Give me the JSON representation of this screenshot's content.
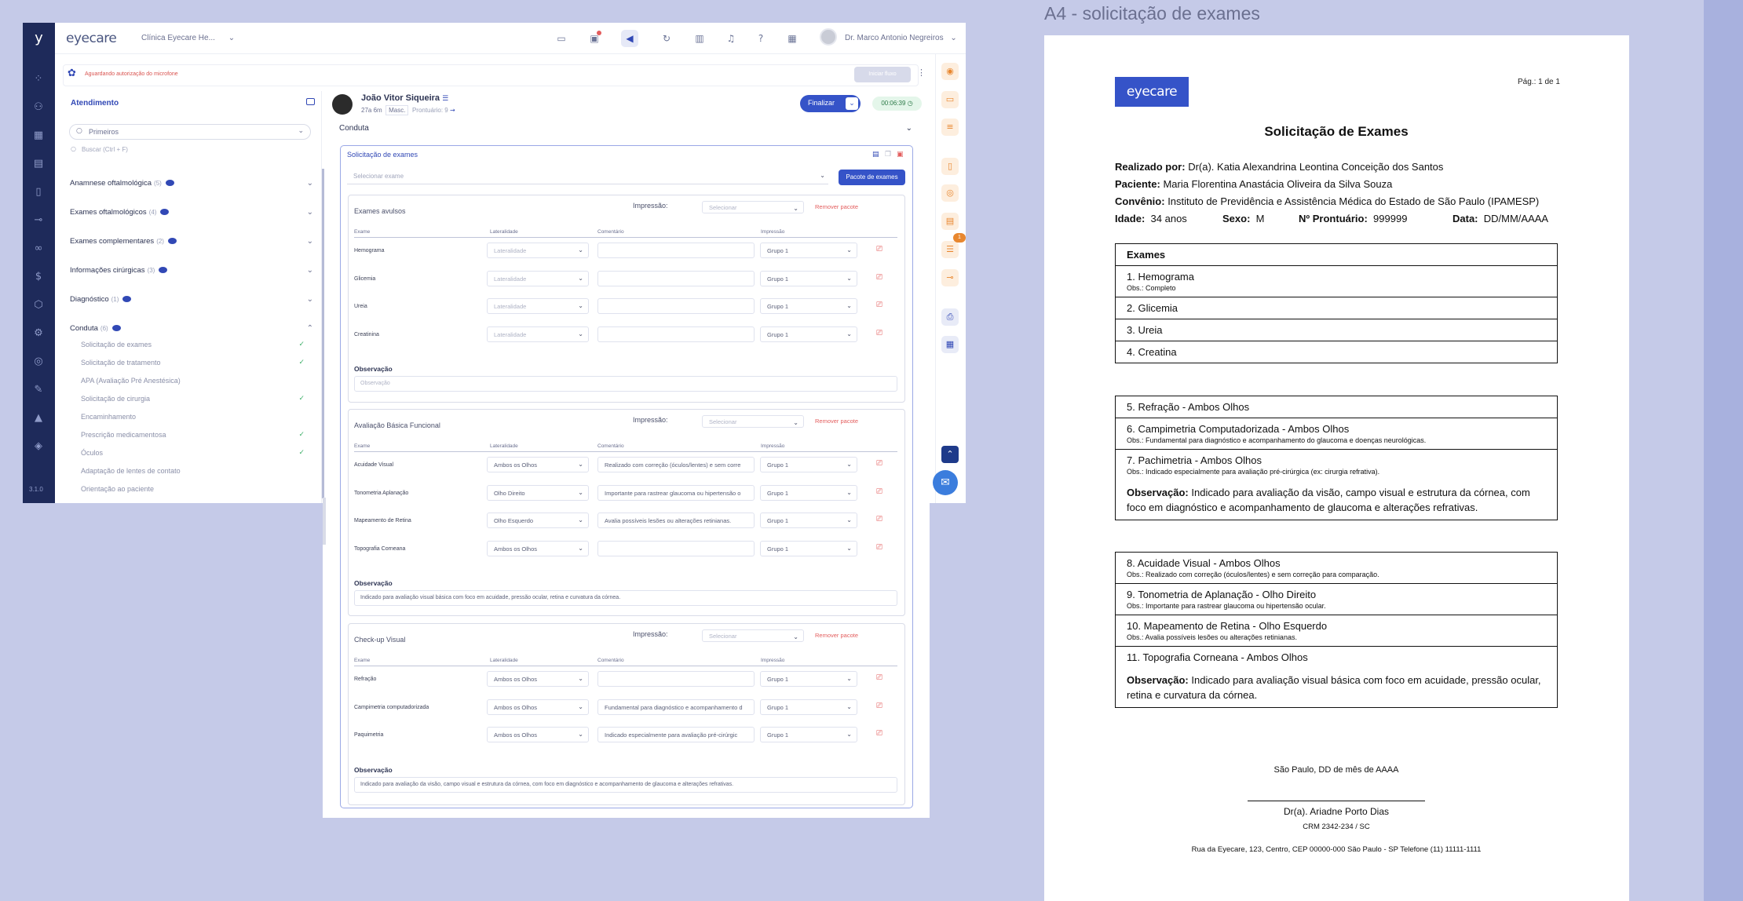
{
  "app": {
    "logo_letter": "y",
    "brand": "eyecare",
    "clinic": "Clínica Eyecare He...",
    "doctor": "Dr. Marco Antonio Negreiros",
    "version": "3.1.0",
    "status": "Aguardando autorização do microfone",
    "lock_button": "Iniciar fluxo"
  },
  "sidebar": {
    "title": "Atendimento",
    "select": "Primeiros",
    "search_placeholder": "Buscar (Ctrl + F)",
    "sections": [
      {
        "label": "Anamnese oftalmológica",
        "count": "(5)"
      },
      {
        "label": "Exames oftalmológicos",
        "count": "(4)"
      },
      {
        "label": "Exames complementares",
        "count": "(2)"
      },
      {
        "label": "Informações cirúrgicas",
        "count": "(3)"
      },
      {
        "label": "Diagnóstico",
        "count": "(1)"
      },
      {
        "label": "Conduta",
        "count": "(6)"
      }
    ],
    "items": [
      "Solicitação de exames",
      "Solicitação de tratamento",
      "APA (Avaliação Pré Anestésica)",
      "Solicitação de cirurgia",
      "Encaminhamento",
      "Prescrição medicamentosa",
      "Óculos",
      "Adaptação de lentes de contato",
      "Orientação ao paciente"
    ]
  },
  "patient": {
    "name": "João Vitor Siqueira",
    "age": "27a 6m",
    "sex": "Masc.",
    "record": "Prontuário: 9"
  },
  "actions": {
    "finalize": "Finalizar",
    "timer": "00:06:39"
  },
  "section_title": "Conduta",
  "exam_card": {
    "title": "Solicitação de exames",
    "select_placeholder": "Selecionar exame",
    "package_button": "Pacote de exames",
    "impression_label": "Impressão:",
    "impression_placeholder": "Selecionar",
    "remove_package": "Remover pacote",
    "col_exam": "Exame",
    "col_laterality": "Lateralidade",
    "col_comment": "Comentário",
    "col_print": "Impressão",
    "obs_label": "Observação",
    "obs_placeholder": "Observação",
    "packages": [
      {
        "title": "Exames avulsos",
        "rows": [
          {
            "exam": "Hemograma",
            "lat": "Lateralidade",
            "comment": "",
            "print": "Grupo 1"
          },
          {
            "exam": "Glicemia",
            "lat": "Lateralidade",
            "comment": "",
            "print": "Grupo 1"
          },
          {
            "exam": "Ureia",
            "lat": "Lateralidade",
            "comment": "",
            "print": "Grupo 1"
          },
          {
            "exam": "Creatinina",
            "lat": "Lateralidade",
            "comment": "",
            "print": "Grupo 1"
          }
        ],
        "obs": ""
      },
      {
        "title": "Avaliação Básica Funcional",
        "rows": [
          {
            "exam": "Acuidade Visual",
            "lat": "Ambos os Olhos",
            "comment": "Realizado com correção (óculos/lentes) e sem corre",
            "print": "Grupo 1"
          },
          {
            "exam": "Tonometria Aplanação",
            "lat": "Olho Direito",
            "comment": "Importante para rastrear glaucoma ou hipertensão o",
            "print": "Grupo 1"
          },
          {
            "exam": "Mapeamento de Retina",
            "lat": "Olho Esquerdo",
            "comment": "Avalia possíveis lesões ou alterações retinianas.",
            "print": "Grupo 1"
          },
          {
            "exam": "Topografia Corneana",
            "lat": "Ambos os Olhos",
            "comment": "",
            "print": "Grupo 1"
          }
        ],
        "obs": "Indicado para avaliação visual básica com foco em acuidade, pressão ocular, retina e curvatura da córnea."
      },
      {
        "title": "Check-up Visual",
        "rows": [
          {
            "exam": "Refração",
            "lat": "Ambos os Olhos",
            "comment": "",
            "print": "Grupo 1"
          },
          {
            "exam": "Campimetria computadorizada",
            "lat": "Ambos os Olhos",
            "comment": "Fundamental para diagnóstico e acompanhamento d",
            "print": "Grupo 1"
          },
          {
            "exam": "Paquimetria",
            "lat": "Ambos os Olhos",
            "comment": "Indicado especialmente para avaliação pré-cirúrgic",
            "print": "Grupo 1"
          }
        ],
        "obs": "Indicado para avaliação da visão, campo visual e estrutura da córnea, com foco em diagnóstico e acompanhamento de glaucoma e alterações refrativas."
      }
    ]
  },
  "rail": {
    "badge": "1"
  },
  "a4": {
    "label": "A4 - solicitação de exames",
    "logo": "eyecare",
    "page": "Pág.: 1 de 1",
    "title": "Solicitação de Exames",
    "by_label": "Realizado por:",
    "by": "Dr(a). Katia Alexandrina Leontina Conceição dos Santos",
    "patient_label": "Paciente:",
    "patient": "Maria Florentina Anastácia Oliveira da Silva Souza",
    "plan_label": "Convênio:",
    "plan": "Instituto de Previdência e Assistência Médica do Estado de São Paulo (IPAMESP)",
    "age_label": "Idade:",
    "age": "34 anos",
    "sex_label": "Sexo:",
    "sex": "M",
    "record_label": "Nº Prontuário:",
    "record": "999999",
    "date_label": "Data:",
    "date": "DD/MM/AAAA",
    "exams_header": "Exames",
    "group1": [
      {
        "text": "1. Hemograma",
        "obs": "Obs.: Completo"
      },
      {
        "text": "2. Glicemia",
        "obs": ""
      },
      {
        "text": "3. Ureia",
        "obs": ""
      },
      {
        "text": "4. Creatina",
        "obs": ""
      }
    ],
    "group2": [
      {
        "text": "5. Refração - Ambos Olhos",
        "obs": ""
      },
      {
        "text": "6. Campimetria Computadorizada - Ambos Olhos",
        "obs": "Obs.: Fundamental para diagnóstico e acompanhamento do glaucoma e doenças neurológicas."
      },
      {
        "text": "7. Pachimetria - Ambos Olhos",
        "obs": "Obs.: Indicado especialmente para avaliação pré-cirúrgica (ex: cirurgia refrativa)."
      }
    ],
    "group2_obs_label": "Observação:",
    "group2_obs": "Indicado para avaliação da visão, campo visual e estrutura da córnea, com foco em diagnóstico e acompanhamento de glaucoma e alterações refrativas.",
    "group3": [
      {
        "text": "8. Acuidade Visual - Ambos Olhos",
        "obs": "Obs.: Realizado com correção (óculos/lentes) e sem correção para comparação."
      },
      {
        "text": "9. Tonometria de Aplanação - Olho Direito",
        "obs": "Obs.: Importante para rastrear glaucoma ou hipertensão ocular."
      },
      {
        "text": "10. Mapeamento de Retina - Olho Esquerdo",
        "obs": "Obs.: Avalia possíveis lesões ou alterações retinianas."
      },
      {
        "text": "11. Topografia Corneana - Ambos Olhos",
        "obs": ""
      }
    ],
    "group3_obs_label": "Observação:",
    "group3_obs": "Indicado para avaliação visual básica com foco em acuidade, pressão ocular, retina e curvatura da córnea.",
    "place": "São Paulo, DD de mês de AAAA",
    "signer": "Dr(a). Ariadne Porto Dias",
    "crm": "CRM 2342-234 / SC",
    "address": "Rua da Eyecare, 123, Centro, CEP 00000-000 São Paulo - SP Telefone (11) 11111-1111"
  }
}
